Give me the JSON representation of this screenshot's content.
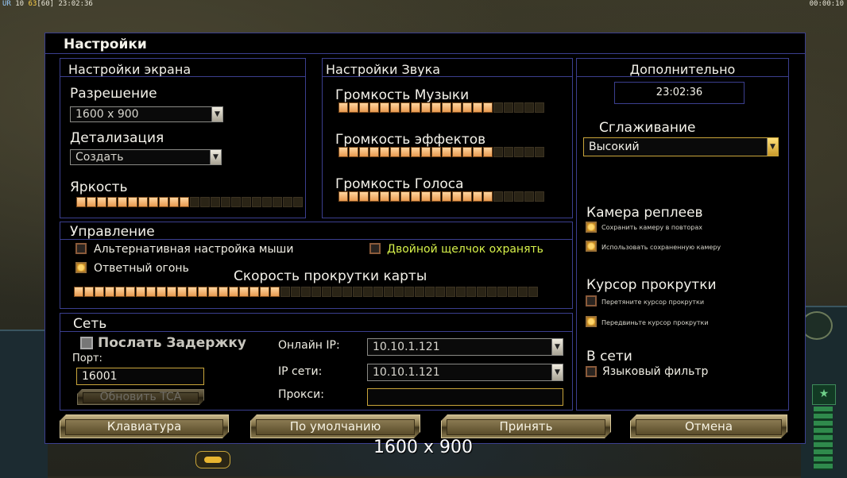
{
  "hud": {
    "top_left": {
      "prefix": "UR",
      "counter_a": "10",
      "fps": "63",
      "fps_cap": "[60]",
      "time": "23:02:36"
    },
    "top_right_timer": "00:00:10",
    "tooltip": "1600 x 900"
  },
  "dialog": {
    "title": "Настройки"
  },
  "screen": {
    "header": "Настройки экрана",
    "resolution_label": "Разрешение",
    "resolution_value": "1600 x 900",
    "detail_label": "Детализация",
    "detail_value": "Создать",
    "brightness_label": "Яркость",
    "brightness_level": 0.5
  },
  "sound": {
    "header": "Настройки Звука",
    "music_label": "Громкость Музыки",
    "music_level": 0.75,
    "effects_label": "Громкость эффектов",
    "effects_level": 0.75,
    "voice_label": "Громкость Голоса",
    "voice_level": 0.75
  },
  "extra": {
    "header": "Дополнительно",
    "clock": "23:02:36",
    "antialias_label": "Сглаживание",
    "antialias_value": "Высокий",
    "replay_camera_label": "Камера реплеев",
    "save_camera_label": "Сохранить камеру в повторах",
    "use_saved_camera_label": "Использовать сохраненную камеру",
    "scroll_cursor_label": "Курсор прокрутки",
    "drag_cursor_label": "Перетяните курсор прокрутки",
    "move_cursor_label": "Передвиньте курсор прокрутки",
    "online_label": "В сети",
    "language_filter_label": "Языковый фильтр"
  },
  "control": {
    "header": "Управление",
    "alt_mouse_label": "Альтернативная настройка мыши",
    "double_click_label": "Двойной щелчок охранять",
    "return_fire_label": "Ответный огонь",
    "scroll_speed_label": "Скорость прокрутки карты",
    "scroll_speed_level": 0.44
  },
  "network": {
    "header": "Сеть",
    "send_delay_label": "Послать Задержку",
    "port_label": "Порт:",
    "port_value": "16001",
    "update_tca_label": "Обновить TCA",
    "online_ip_label": "Онлайн IP:",
    "online_ip_value": "10.10.1.121",
    "lan_ip_label": "IP сети:",
    "lan_ip_value": "10.10.1.121",
    "proxy_label": "Прокси:",
    "proxy_value": ""
  },
  "buttons": {
    "keyboard": "Клавиатура",
    "defaults": "По умолчанию",
    "accept": "Принять",
    "cancel": "Отмена"
  },
  "colors": {
    "panel_border": "#3b3f8f",
    "slider_on": "#f2b070",
    "highlight_text": "#d6f04a",
    "gold_border": "#c9a53a"
  }
}
